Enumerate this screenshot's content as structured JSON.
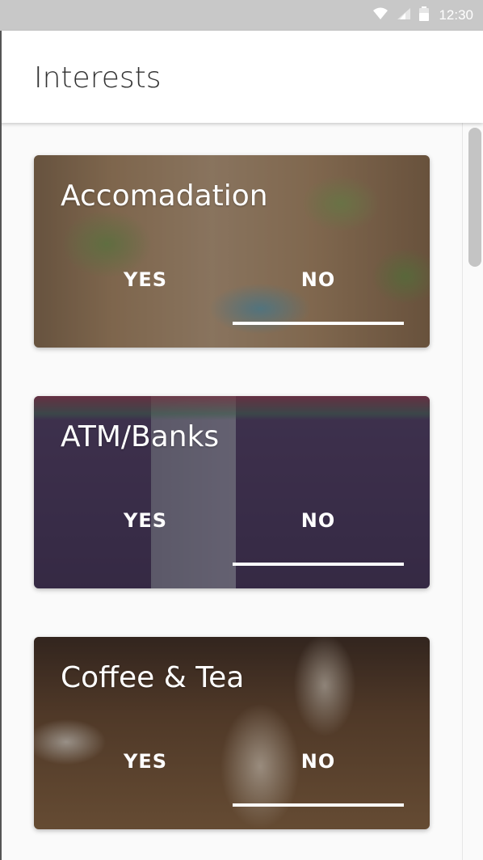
{
  "status_bar": {
    "time": "12:30",
    "icons": [
      "wifi-icon",
      "signal-icon",
      "battery-icon"
    ]
  },
  "app_bar": {
    "title": "Interests"
  },
  "cards": [
    {
      "title": "Accomadation",
      "yes_label": "YES",
      "no_label": "NO",
      "selected": "NO"
    },
    {
      "title": "ATM/Banks",
      "yes_label": "YES",
      "no_label": "NO",
      "selected": "NO"
    },
    {
      "title": "Coffee & Tea",
      "yes_label": "YES",
      "no_label": "NO",
      "selected": "NO"
    }
  ],
  "colors": {
    "status_bar": "#c8c8c8",
    "app_bar": "#ffffff",
    "title_text": "#333333",
    "card_text": "#ffffff"
  }
}
